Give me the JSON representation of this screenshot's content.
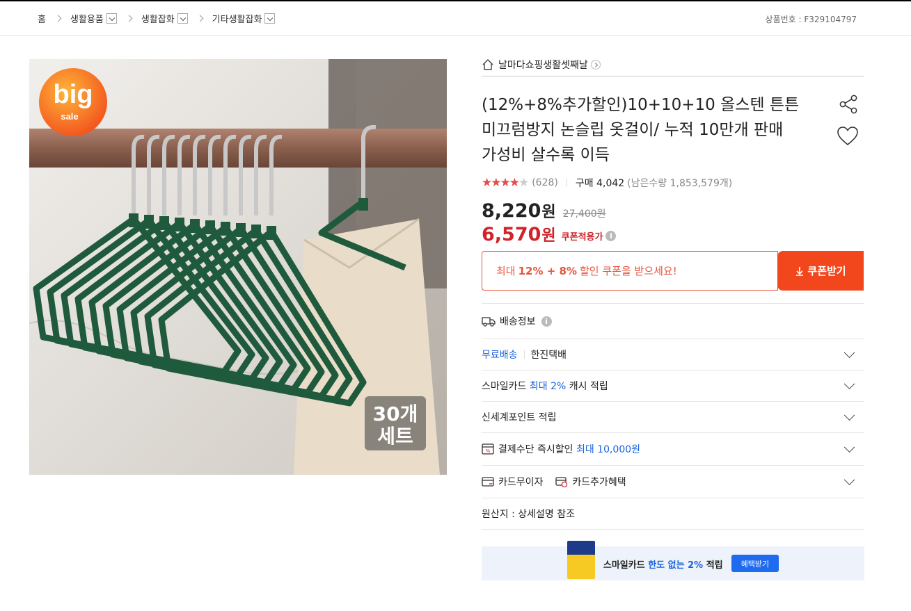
{
  "breadcrumb": {
    "home": "홈",
    "items": [
      "생활용품",
      "생활잡화",
      "기타생활잡화"
    ]
  },
  "product_no": "상품번호 : F329104797",
  "image": {
    "badge_top": "big",
    "badge_bottom": "sale",
    "set_label_line1": "30개",
    "set_label_line2": "세트"
  },
  "shop": {
    "name": "날마다쇼핑생활셋째날"
  },
  "title": "(12%+8%추가할인)10+10+10 올스텐 튼튼 미끄럼방지 논슬립 옷걸이/ 누적 10만개 판매 가성비 살수록 이득",
  "rating": {
    "stars": 4,
    "count": "(628)",
    "purchases": "구매 4,042",
    "remaining": "(남은수량 1,853,579개)"
  },
  "price": {
    "sale": "8,220",
    "unit": "원",
    "original": "27,400원",
    "coupon_price": "6,570",
    "coupon_label": "쿠폰적용가"
  },
  "coupon": {
    "text_before": "최대",
    "text_bold": "12% + 8%",
    "text_after": "할인 쿠폰을 받으세요!",
    "button": "쿠폰받기"
  },
  "delivery": {
    "heading": "배송정보",
    "free_shipping": "무료배송",
    "courier": "한진택배"
  },
  "rows": {
    "smilecard_pre": "스마일카드",
    "smilecard_highlight": "최대 2%",
    "smilecard_post": "캐시 적립",
    "shinsegae": "신세계포인트 적립",
    "payment_pre": "결제수단 즉시할인",
    "payment_highlight": "최대 10,000원",
    "installment": "카드무이자",
    "card_benefit": "카드추가혜택",
    "origin": "원산지 : 상세설명 참조"
  },
  "banner": {
    "text_pre": "스마일카드",
    "text_highlight": "한도 없는 2%",
    "text_post": "적립",
    "button": "혜택받기"
  },
  "colors": {
    "accent_red": "#d0232a",
    "coupon_orange": "#f2461c",
    "link_blue": "#1b62d8",
    "star_red": "#e44d4d"
  }
}
